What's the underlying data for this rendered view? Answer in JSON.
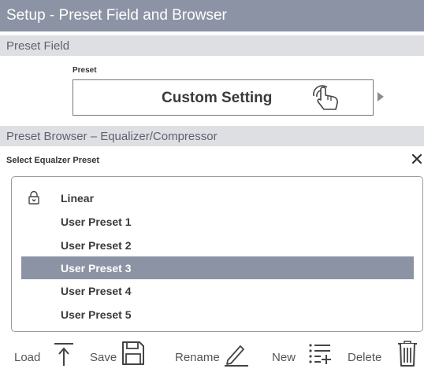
{
  "title": "Setup - Preset Field and Browser",
  "preset_field": {
    "section_title": "Preset Field",
    "label": "Preset",
    "value": "Custom Setting"
  },
  "browser": {
    "section_title": "Preset Browser – Equalizer/Compressor",
    "select_label": "Select Equalzer Preset",
    "items": [
      {
        "label": "Linear",
        "locked": true,
        "selected": false
      },
      {
        "label": "User Preset 1",
        "locked": false,
        "selected": false
      },
      {
        "label": "User Preset 2",
        "locked": false,
        "selected": false
      },
      {
        "label": "User Preset 3",
        "locked": false,
        "selected": true
      },
      {
        "label": "User Preset 4",
        "locked": false,
        "selected": false
      },
      {
        "label": "User Preset 5",
        "locked": false,
        "selected": false
      }
    ]
  },
  "toolbar": {
    "load": "Load",
    "save": "Save",
    "rename": "Rename",
    "new": "New",
    "delete": "Delete"
  },
  "colors": {
    "accent": "#8c93a4",
    "section_bg": "#dedfe3"
  },
  "icons": [
    "hand-pointer-icon",
    "arrow-right-icon",
    "close-icon",
    "lock-icon",
    "load-arrow-icon",
    "save-disk-icon",
    "rename-pencil-icon",
    "new-list-icon",
    "delete-trash-icon"
  ]
}
